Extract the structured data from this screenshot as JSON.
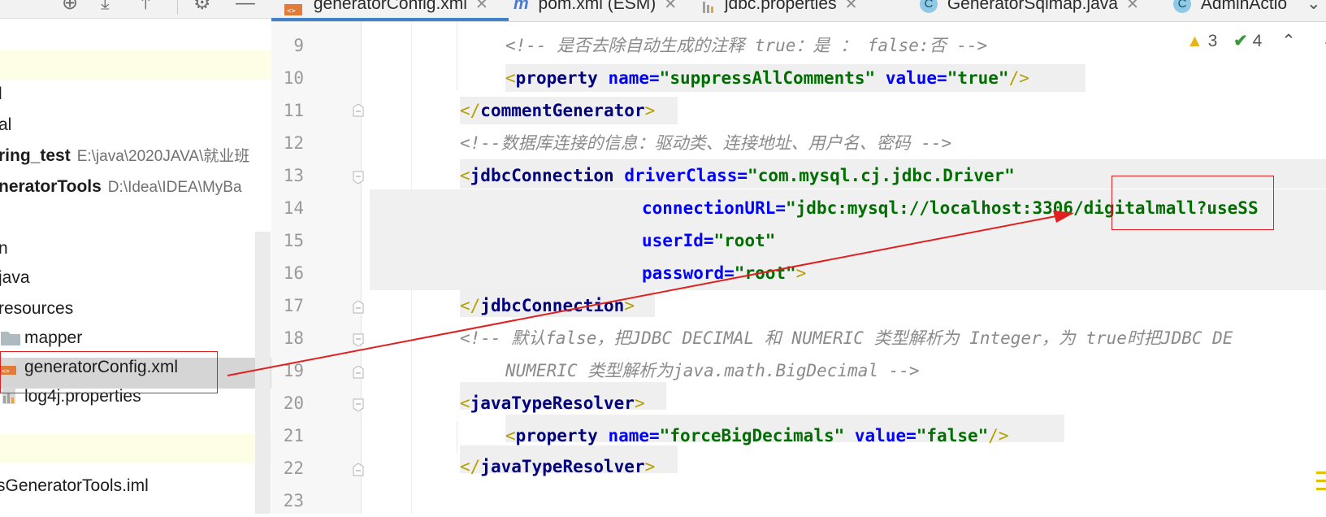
{
  "toolbar": {
    "icons": [
      "add-icon",
      "expand-all-icon",
      "collapse-all-icon",
      "gear-icon",
      "minimize-icon"
    ]
  },
  "project_tree": {
    "rows": [
      {
        "label": "l",
        "path": ""
      },
      {
        "label": "al",
        "path": ""
      },
      {
        "label": "ring_test",
        "path": "E:\\java\\2020JAVA\\就业班"
      },
      {
        "label": "neratorTools",
        "path": "D:\\Idea\\IDEA\\MyBa"
      },
      {
        "label": "n",
        "path": ""
      },
      {
        "label": "java",
        "path": ""
      },
      {
        "label": "resources",
        "path": ""
      },
      {
        "label": "mapper",
        "path": ""
      },
      {
        "label": "generatorConfig.xml",
        "path": ""
      },
      {
        "label": "log4j.properties",
        "path": ""
      },
      {
        "label": "sGeneratorTools.iml",
        "path": ""
      }
    ]
  },
  "tabs": [
    {
      "label": "generatorConfig.xml",
      "icon": "xml-file-icon",
      "active": true
    },
    {
      "label": "pom.xml (ESM)",
      "icon": "maven-icon",
      "active": false
    },
    {
      "label": "jdbc.properties",
      "icon": "properties-file-icon",
      "active": false
    },
    {
      "label": "GeneratorSqlmap.java",
      "icon": "java-class-icon",
      "active": false
    },
    {
      "label": "AdminActio",
      "icon": "java-class-icon",
      "active": false
    }
  ],
  "inspections": {
    "warnings": "3",
    "weak_warnings": "4"
  },
  "editor": {
    "line_numbers": [
      "9",
      "10",
      "11",
      "12",
      "13",
      "14",
      "15",
      "16",
      "17",
      "18",
      "19",
      "20",
      "21",
      "22",
      "23"
    ],
    "lines": {
      "l9_comment": "<!-- 是否去除自动生成的注释 true：是 ： false:否 -->",
      "l10_open": "<",
      "l10_tag": "property",
      "l10_attr1": " name=",
      "l10_val1": "\"suppressAllComments\"",
      "l10_attr2": " value=",
      "l10_val2": "\"true\"",
      "l10_close": "/>",
      "l11_open": "</",
      "l11_tag": "commentGenerator",
      "l11_close": ">",
      "l12_comment": "<!--数据库连接的信息：驱动类、连接地址、用户名、密码 -->",
      "l13_open": "<",
      "l13_tag": "jdbcConnection",
      "l13_attr": " driverClass=",
      "l13_val": "\"com.mysql.cj.jdbc.Driver\"",
      "l14_attr": "connectionURL=",
      "l14_val": "\"jdbc:mysql://localhost:3306/digitalmall?useSS",
      "l15_attr": "userId=",
      "l15_val": "\"root\"",
      "l16_attr": "password=",
      "l16_val": "\"root\"",
      "l16_close": ">",
      "l17_open": "</",
      "l17_tag": "jdbcConnection",
      "l17_close": ">",
      "l18_comment": "<!-- 默认false，把JDBC DECIMAL 和 NUMERIC 类型解析为 Integer，为 true时把JDBC DE",
      "l19_comment": "NUMERIC 类型解析为java.math.BigDecimal -->",
      "l20_open": "<",
      "l20_tag": "javaTypeResolver",
      "l20_close": ">",
      "l21_open": "<",
      "l21_tag": "property",
      "l21_attr1": " name=",
      "l21_val1": "\"forceBigDecimals\"",
      "l21_attr2": " value=",
      "l21_val2": "\"false\"",
      "l21_close": "/>",
      "l22_open": "</",
      "l22_tag": "javaTypeResolver",
      "l22_close": ">"
    }
  },
  "colors": {
    "annotation_red": "#e02020",
    "active_tab_accent": "#4083c9",
    "tag": "#00007f",
    "attr_name": "#0000ff",
    "attr_value": "#006e00",
    "comment": "#8a8a8a"
  }
}
